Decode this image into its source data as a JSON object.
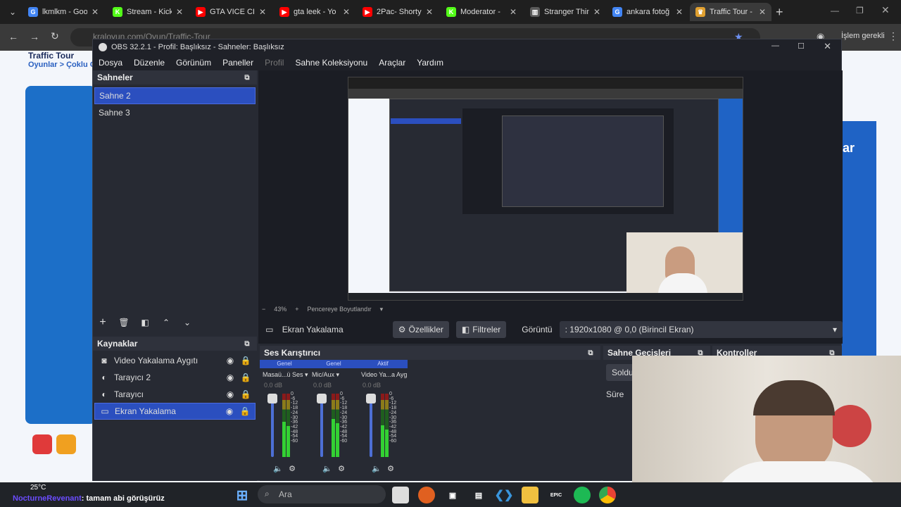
{
  "browser": {
    "tabs": [
      {
        "title": "lkmlkm - Goo",
        "fav": "G",
        "color": "#4285f4"
      },
      {
        "title": "Stream - Kick",
        "fav": "K",
        "color": "#53fc18"
      },
      {
        "title": "GTA VICE CIT",
        "fav": "▶",
        "color": "#ff0000"
      },
      {
        "title": "gta leek - Yo",
        "fav": "▶",
        "color": "#ff0000"
      },
      {
        "title": "2Pac- Shorty",
        "fav": "▶",
        "color": "#ff0000"
      },
      {
        "title": "Moderator - ",
        "fav": "K",
        "color": "#53fc18"
      },
      {
        "title": "Stranger Thin",
        "fav": "▥",
        "color": "#5a5a5a"
      },
      {
        "title": "ankara fotoğ",
        "fav": "G",
        "color": "#4285f4"
      },
      {
        "title": "Traffic Tour -",
        "fav": "♛",
        "color": "#e0a030"
      }
    ],
    "url": "kraloyun.com/Oyun/Traffic-Tour",
    "error_label": "İşlem gerekli"
  },
  "background_page": {
    "title": "Traffic Tour",
    "breadcrumb": "Oyunlar > Çoklu O"
  },
  "obs": {
    "window_title": "OBS 32.2.1 - Profil: Başlıksız - Sahneler: Başlıksız",
    "menu": [
      "Dosya",
      "Düzenle",
      "Görünüm",
      "Paneller",
      "Profil",
      "Sahne Koleksiyonu",
      "Araçlar",
      "Yardım"
    ],
    "scenes": {
      "header": "Sahneler",
      "items": [
        "Sahne 2",
        "Sahne 3"
      ]
    },
    "sources": {
      "header": "Kaynaklar",
      "items": [
        {
          "label": "Video Yakalama Aygıtı",
          "icon": "camera-icon"
        },
        {
          "label": "Tarayıcı 2",
          "icon": "globe-icon"
        },
        {
          "label": "Tarayıcı",
          "icon": "globe-icon"
        },
        {
          "label": "Ekran Yakalama",
          "icon": "monitor-icon"
        }
      ]
    },
    "zoom": "43%",
    "fit_label": "Pencereye Boyutlandır",
    "source_bar": {
      "name": "Ekran Yakalama",
      "properties": "Özellikler",
      "filters": "Filtreler",
      "display_label": "Görüntü",
      "display_value": ": 1920x1080 @ 0,0 (Birincil Ekran)"
    },
    "mixer": {
      "header": "Ses Karıştırıcı",
      "channels": [
        {
          "tag": "Genel",
          "name": "Masaü...ü Ses",
          "db": "0.0 dB",
          "level": 0.55
        },
        {
          "tag": "Genel",
          "name": "Mic/Aux",
          "db": "0.0 dB",
          "level": 0.6
        },
        {
          "tag": "Aktif",
          "name": "Video Ya...a Aygıtı",
          "db": "0.0 dB",
          "level": 0.5
        }
      ],
      "scale": [
        "0",
        "-6",
        "-12",
        "-18",
        "-24",
        "-30",
        "-36",
        "-42",
        "-48",
        "-54",
        "-60"
      ]
    },
    "transitions": {
      "header": "Sahne Geçişleri",
      "value": "Soldu",
      "duration_label": "Süre"
    },
    "controls": {
      "header": "Kontroller"
    }
  },
  "chat": {
    "user": "NocturneRevenant",
    "message": ": tamam abi görüşürüz"
  },
  "taskbar": {
    "temp": "25°C",
    "search": "Ara"
  }
}
